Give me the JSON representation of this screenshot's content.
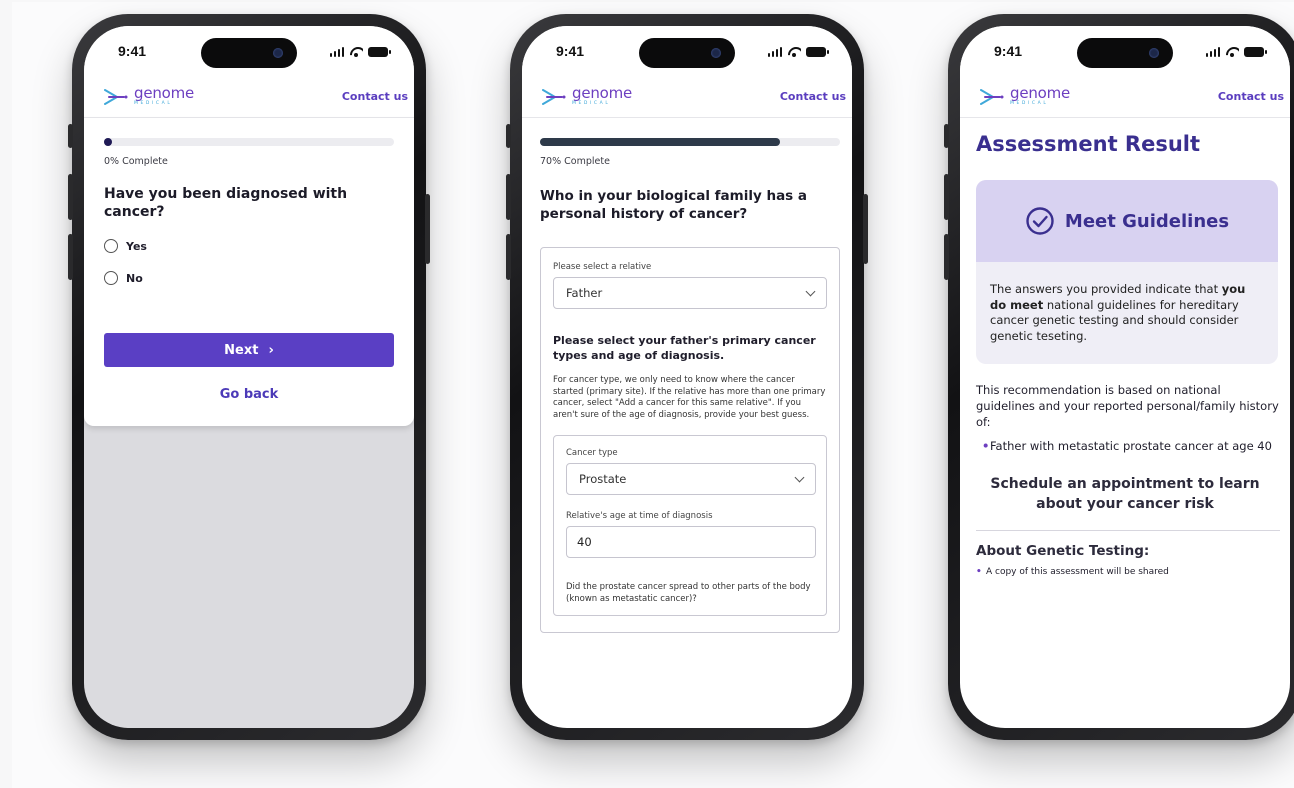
{
  "status": {
    "time": "9:41"
  },
  "brand": {
    "name": "genome",
    "sub": "MEDICAL",
    "contact": "Contact us"
  },
  "screen1": {
    "progress_label": "0% Complete",
    "progress": 0,
    "question": "Have you been diagnosed with cancer?",
    "options": [
      "Yes",
      "No"
    ],
    "next_label": "Next",
    "next_arrow": "›",
    "back_label": "Go back"
  },
  "screen2": {
    "progress_label": "70% Complete",
    "progress": 0.8,
    "question": "Who in your biological family has a personal history of cancer?",
    "relative_label": "Please select a relative",
    "relative_value": "Father",
    "subquestion": "Please select your father's primary cancer types and age of diagnosis.",
    "help": "For cancer type, we only need to know where the cancer started (primary site). If the relative has more than one primary cancer, select \"Add a cancer for this same relative\". If you aren't sure of the age of diagnosis, provide your best guess.",
    "cancer_type_label": "Cancer type",
    "cancer_type_value": "Prostate",
    "age_label": "Relative's age at time of diagnosis",
    "age_value": "40",
    "spread_question": "Did the prostate cancer spread to other parts of the body (known as metastatic cancer)?"
  },
  "screen3": {
    "title": "Assessment Result",
    "status": "Meet Guidelines",
    "body_pre": "The answers you provided indicate that ",
    "body_bold": "you do meet",
    "body_post": " national guidelines for hereditary cancer genetic testing and should consider genetic teseting.",
    "recommendation": "This recommendation is based on national guidelines and your reported personal/family history of:",
    "history_item": "Father with metastatic prostate cancer at age 40",
    "schedule": "Schedule an appointment to learn about your cancer risk",
    "about_title": "About Genetic Testing:",
    "about_item": "A copy of this assessment will be shared"
  }
}
